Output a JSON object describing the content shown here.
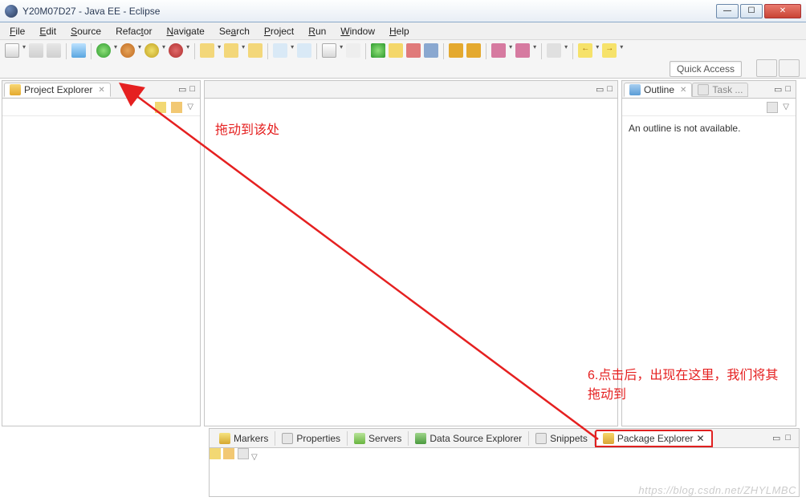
{
  "window": {
    "title": "Y20M07D27 - Java EE - Eclipse"
  },
  "menu": {
    "file": "File",
    "edit": "Edit",
    "source": "Source",
    "refactor": "Refactor",
    "navigate": "Navigate",
    "search": "Search",
    "project": "Project",
    "run": "Run",
    "window": "Window",
    "help": "Help"
  },
  "toolbar": {
    "quick_access": "Quick Access"
  },
  "left_panel": {
    "tab_label": "Project Explorer"
  },
  "right_panel": {
    "outline_tab": "Outline",
    "task_tab": "Task ...",
    "body_text": "An outline is not available."
  },
  "bottom_panel": {
    "markers": "Markers",
    "properties": "Properties",
    "servers": "Servers",
    "data_source": "Data Source Explorer",
    "snippets": "Snippets",
    "package_explorer": "Package Explorer"
  },
  "annotations": {
    "top_note": "拖动到该处",
    "bottom_note": "6.点击后，出现在这里，我们将其拖动到"
  },
  "watermark": "https://blog.csdn.net/ZHYLMBC"
}
